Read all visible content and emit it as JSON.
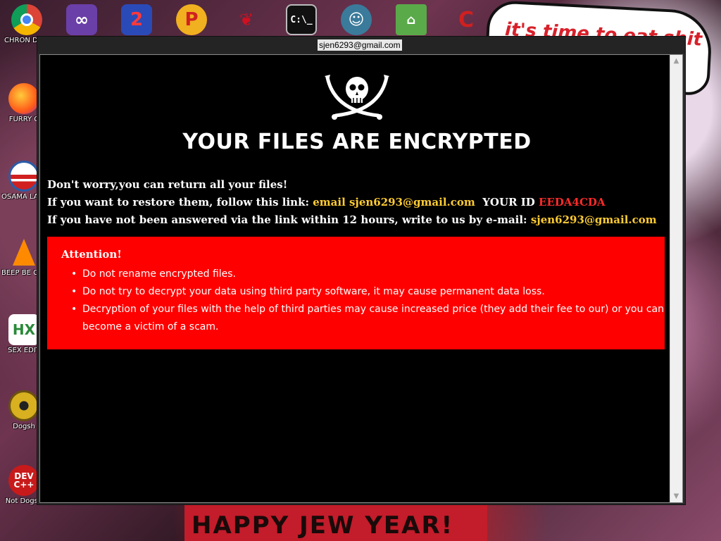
{
  "desktop": {
    "icons": [
      {
        "label": "CHRON DISEA",
        "icon": "chrome-icon",
        "color": "#1a73e8"
      },
      {
        "label": "",
        "icon": "visual-studio-icon",
        "color": "#6a3fa8"
      },
      {
        "label": "",
        "icon": "pinball-icon",
        "color": "#d23030"
      },
      {
        "label": "",
        "icon": "p-logo-icon",
        "color": "#e0902a"
      },
      {
        "label": "",
        "icon": "bat-icon",
        "color": "#b01020"
      },
      {
        "label": "",
        "icon": "cmd-icon",
        "color": "#111111"
      },
      {
        "label": "",
        "icon": "santa-icon",
        "color": "#3a7a9a"
      },
      {
        "label": "",
        "icon": "folder-icon",
        "color": "#4a9a3a"
      },
      {
        "label": "",
        "icon": "red-c-icon",
        "color": "#d02020"
      },
      {
        "label": "FURRY C",
        "icon": "firefox-icon",
        "color": "#ff7a1a"
      },
      {
        "label": "OSAMA LADEN",
        "icon": "obama-logo-icon",
        "color": "#2a5ca8"
      },
      {
        "label": "BEEP BE CAR",
        "icon": "vlc-icon",
        "color": "#ff8a00"
      },
      {
        "label": "SEX EDIT",
        "icon": "hx-icon",
        "color": "#2a8a3a"
      },
      {
        "label": "Dogsh",
        "icon": "disc-icon",
        "color": "#c8a020"
      },
      {
        "label": "Not Dogsh",
        "icon": "dev-cpp-icon",
        "color": "#c81a1a"
      }
    ],
    "wallpaper_text": "it's time to eat shit",
    "wallpaper_bottom": "HAPPY JEW YEAR!"
  },
  "window": {
    "title": "sjen6293@gmail.com",
    "headline": "YOUR FILES ARE ENCRYPTED",
    "line1": "Don't worry,you can return all your files!",
    "line2_prefix": "If you want to restore them, follow this link:",
    "line2_link": "email sjen6293@gmail.com",
    "line2_id_label": "YOUR ID",
    "line2_id": "EEDA4CDA",
    "line3_prefix": "If you have not been answered via the link within 12 hours, write to us by e-mail:",
    "line3_email": "sjen6293@gmail.com",
    "attention": {
      "title": "Attention!",
      "items": [
        "Do not rename encrypted files.",
        "Do not try to decrypt your data using third party software, it may cause permanent data loss.",
        "Decryption of your files with the help of third parties may cause increased price (they add their fee to our) or you can become a victim of a scam."
      ]
    }
  },
  "colors": {
    "background": "#000000",
    "alert_box": "#ff0000",
    "highlight": "#ffcc33",
    "id_color": "#ff2a2a"
  }
}
